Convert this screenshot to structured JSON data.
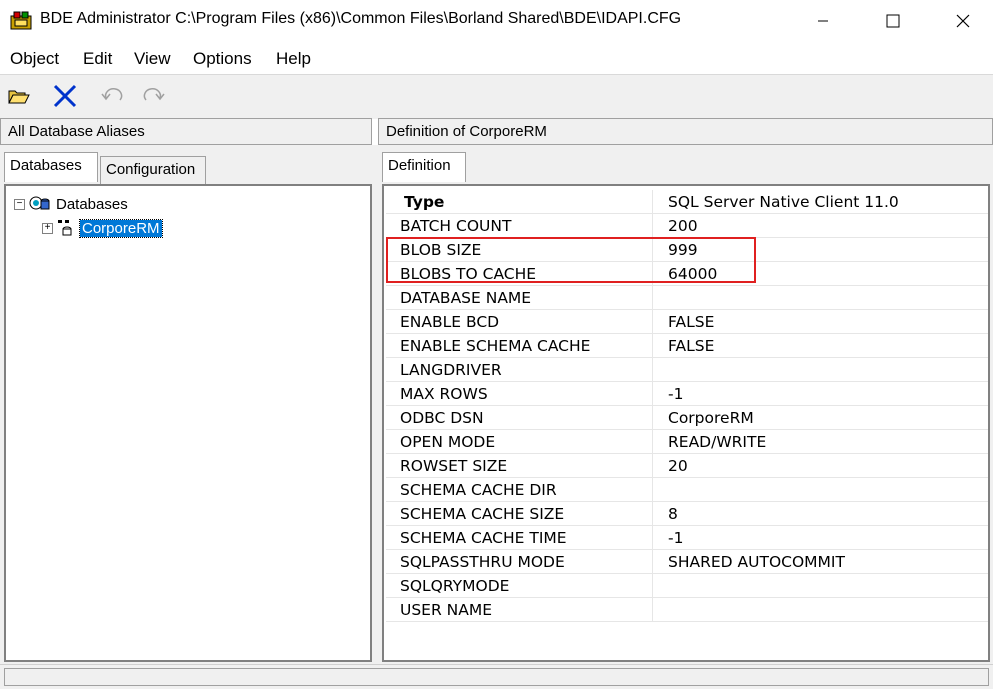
{
  "window": {
    "title": "BDE Administrator  C:\\Program Files (x86)\\Common Files\\Borland Shared\\BDE\\IDAPI.CFG",
    "controls": [
      "minimize-icon",
      "maximize-icon",
      "close-icon"
    ]
  },
  "menu": {
    "items": [
      {
        "label": "Object"
      },
      {
        "label": "Edit"
      },
      {
        "label": "View"
      },
      {
        "label": "Options"
      },
      {
        "label": "Help"
      }
    ]
  },
  "toolbar": {
    "buttons": [
      "open-folder-icon",
      "delete-icon",
      "undo-icon",
      "redo-icon"
    ]
  },
  "left_pane": {
    "header": "All Database Aliases",
    "tabs": [
      {
        "label": "Databases",
        "active": true
      },
      {
        "label": "Configuration",
        "active": false
      }
    ],
    "tree": {
      "root": "Databases",
      "children": [
        {
          "label": "CorporeRM",
          "selected": true
        }
      ]
    }
  },
  "right_pane": {
    "header": "Definition of CorporeRM",
    "tabs": [
      {
        "label": "Definition",
        "active": true
      }
    ],
    "rows": [
      {
        "key": "Type",
        "value": "SQL Server Native Client 11.0"
      },
      {
        "key": "BATCH COUNT",
        "value": "200"
      },
      {
        "key": "BLOB SIZE",
        "value": "999"
      },
      {
        "key": "BLOBS TO CACHE",
        "value": "64000"
      },
      {
        "key": "DATABASE NAME",
        "value": ""
      },
      {
        "key": "ENABLE BCD",
        "value": "FALSE"
      },
      {
        "key": "ENABLE SCHEMA CACHE",
        "value": "FALSE"
      },
      {
        "key": "LANGDRIVER",
        "value": ""
      },
      {
        "key": "MAX ROWS",
        "value": "-1"
      },
      {
        "key": "ODBC DSN",
        "value": "CorporeRM"
      },
      {
        "key": "OPEN MODE",
        "value": "READ/WRITE"
      },
      {
        "key": "ROWSET SIZE",
        "value": "20"
      },
      {
        "key": "SCHEMA CACHE DIR",
        "value": ""
      },
      {
        "key": "SCHEMA CACHE SIZE",
        "value": "8"
      },
      {
        "key": "SCHEMA CACHE TIME",
        "value": "-1"
      },
      {
        "key": "SQLPASSTHRU MODE",
        "value": "SHARED AUTOCOMMIT"
      },
      {
        "key": "SQLQRYMODE",
        "value": ""
      },
      {
        "key": "USER NAME",
        "value": ""
      }
    ]
  },
  "colors": {
    "selection": "#0078d7",
    "highlight_border": "#e02020",
    "delete_icon": "#0033cc"
  }
}
